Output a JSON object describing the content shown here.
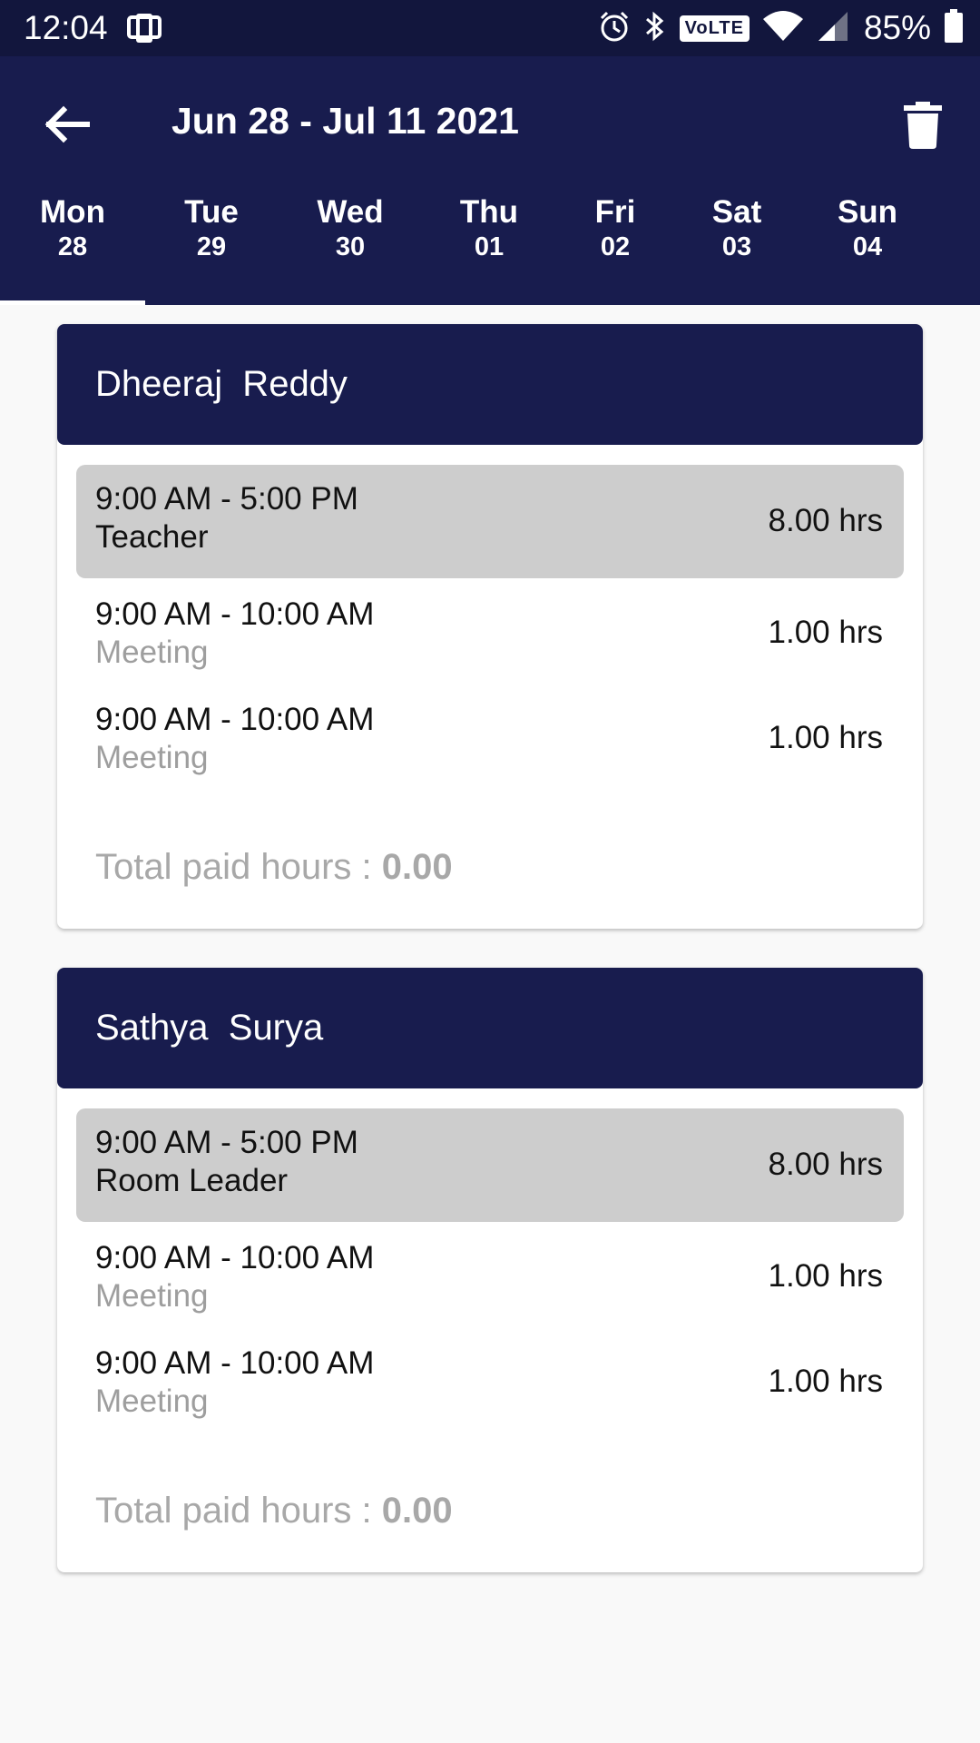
{
  "status_bar": {
    "time": "12:04",
    "battery": "85%",
    "network_badge": "VoLTE",
    "icons": [
      "alarm-icon",
      "bluetooth-icon",
      "volte-icon",
      "wifi-icon",
      "signal-icon",
      "battery-icon"
    ]
  },
  "app_bar": {
    "title": "Jun 28 - Jul 11 2021",
    "back_icon": "arrow-left-icon",
    "delete_icon": "trash-icon"
  },
  "day_tabs": [
    {
      "name": "Mon",
      "num": "28",
      "selected": true
    },
    {
      "name": "Tue",
      "num": "29"
    },
    {
      "name": "Wed",
      "num": "30"
    },
    {
      "name": "Thu",
      "num": "01"
    },
    {
      "name": "Fri",
      "num": "02"
    },
    {
      "name": "Sat",
      "num": "03"
    },
    {
      "name": "Sun",
      "num": "04"
    }
  ],
  "employees": [
    {
      "name": "Dheeraj  Reddy",
      "shift": {
        "time": "9:00 AM - 5:00 PM",
        "role": "Teacher",
        "hours": "8.00 hrs"
      },
      "events": [
        {
          "time": "9:00 AM - 10:00 AM",
          "type": "Meeting",
          "hours": "1.00 hrs"
        },
        {
          "time": "9:00 AM - 10:00 AM",
          "type": "Meeting",
          "hours": "1.00 hrs"
        }
      ],
      "total_label": "Total paid hours : ",
      "total_value": "0.00"
    },
    {
      "name": "Sathya  Surya",
      "shift": {
        "time": "9:00 AM - 5:00 PM",
        "role": "Room Leader",
        "hours": "8.00 hrs"
      },
      "events": [
        {
          "time": "9:00 AM - 10:00 AM",
          "type": "Meeting",
          "hours": "1.00 hrs"
        },
        {
          "time": "9:00 AM - 10:00 AM",
          "type": "Meeting",
          "hours": "1.00 hrs"
        }
      ],
      "total_label": "Total paid hours : ",
      "total_value": "0.00"
    }
  ],
  "colors": {
    "status_bar": "#12163d",
    "primary": "#181c4e",
    "shift_row": "#cdcdcd",
    "muted_text": "#9e9e9e",
    "background": "#f9f9f9"
  }
}
